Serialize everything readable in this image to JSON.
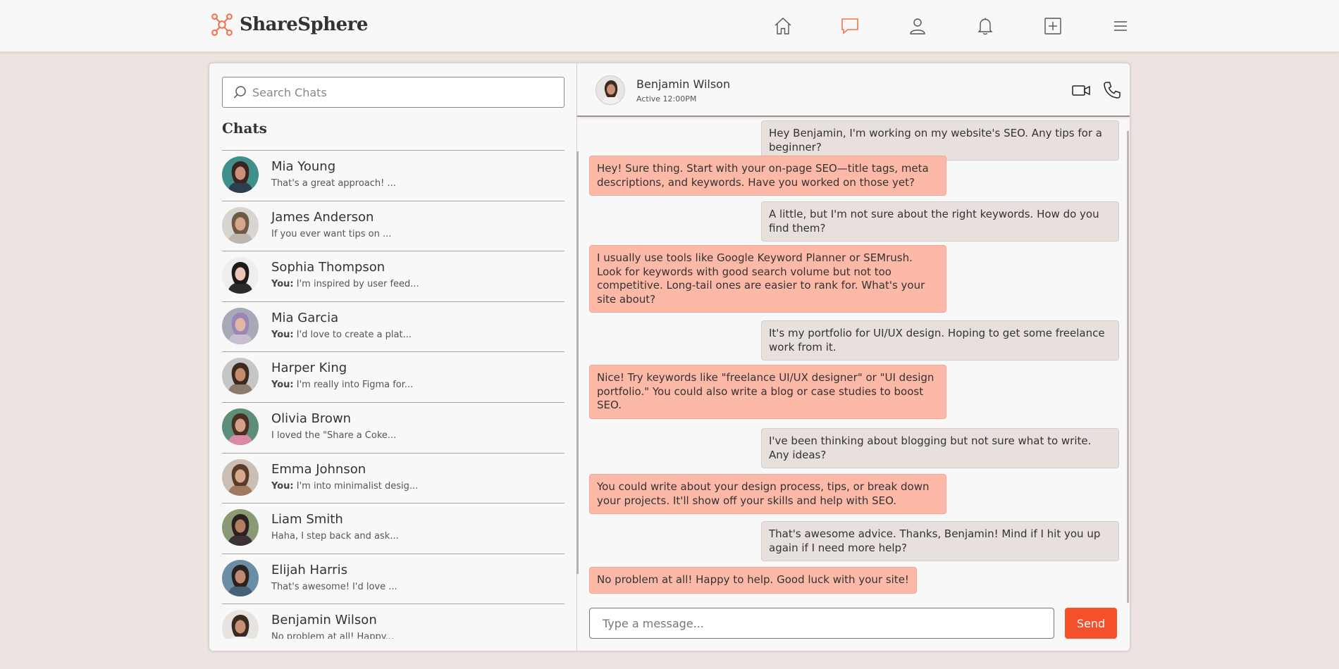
{
  "app": {
    "name": "ShareSphere",
    "accent": "#f4502a",
    "logo_color": "#f0734f"
  },
  "nav": {
    "items": [
      {
        "icon": "home-icon"
      },
      {
        "icon": "chat-icon",
        "active": true
      },
      {
        "icon": "profile-icon"
      },
      {
        "icon": "bell-icon"
      },
      {
        "icon": "add-post-icon"
      },
      {
        "icon": "menu-icon"
      }
    ]
  },
  "sidebar": {
    "search_placeholder": "Search Chats",
    "title": "Chats",
    "chats": [
      {
        "name": "Mia Young",
        "you": "",
        "preview": "That's a great approach! ..."
      },
      {
        "name": "James Anderson",
        "you": "",
        "preview": "If you ever want tips on ..."
      },
      {
        "name": "Sophia Thompson",
        "you": "You:",
        "preview": "I'm inspired by user feed..."
      },
      {
        "name": "Mia Garcia",
        "you": "You:",
        "preview": "I'd love to create a plat..."
      },
      {
        "name": "Harper King",
        "you": "You:",
        "preview": "I'm really into Figma for..."
      },
      {
        "name": "Olivia Brown",
        "you": "",
        "preview": "I loved the \"Share a Coke..."
      },
      {
        "name": "Emma Johnson",
        "you": "You:",
        "preview": "I'm into minimalist desig..."
      },
      {
        "name": "Liam Smith",
        "you": "",
        "preview": "Haha, I step back and ask..."
      },
      {
        "name": "Elijah Harris",
        "you": "",
        "preview": "That's awesome! I'd love ..."
      },
      {
        "name": "Benjamin Wilson",
        "you": "",
        "preview": "No problem at all! Happy..."
      }
    ]
  },
  "conversation": {
    "contact_name": "Benjamin Wilson",
    "status": "Active 12:00PM",
    "messages": [
      {
        "dir": "out",
        "text": "Hey Benjamin, I'm working on my website's SEO. Any tips for a beginner?"
      },
      {
        "dir": "in",
        "text": "Hey! Sure thing. Start with your on-page SEO—title tags, meta descriptions, and keywords. Have you worked on those yet?"
      },
      {
        "dir": "out",
        "text": "A little, but I'm not sure about the right keywords. How do you find them?"
      },
      {
        "dir": "in",
        "text": "I usually use tools like Google Keyword Planner or SEMrush. Look for keywords with good search volume but not too competitive. Long-tail ones are easier to rank for. What's your site about?"
      },
      {
        "dir": "out",
        "text": "It's my portfolio for UI/UX design. Hoping to get some freelance work from it."
      },
      {
        "dir": "in",
        "text": "Nice! Try keywords like \"freelance UI/UX designer\" or \"UI design portfolio.\" You could also write a blog or case studies to boost SEO."
      },
      {
        "dir": "out",
        "text": "I've been thinking about blogging but not sure what to write. Any ideas?"
      },
      {
        "dir": "in",
        "text": "You could write about your design process, tips, or break down your projects. It'll show off your skills and help with SEO."
      },
      {
        "dir": "out",
        "text": "That's awesome advice. Thanks, Benjamin! Mind if I hit you up again if I need more help?"
      },
      {
        "dir": "in",
        "text": "No problem at all! Happy to help. Good luck with your site!"
      }
    ],
    "composer_placeholder": "Type a message...",
    "send_label": "Send"
  }
}
